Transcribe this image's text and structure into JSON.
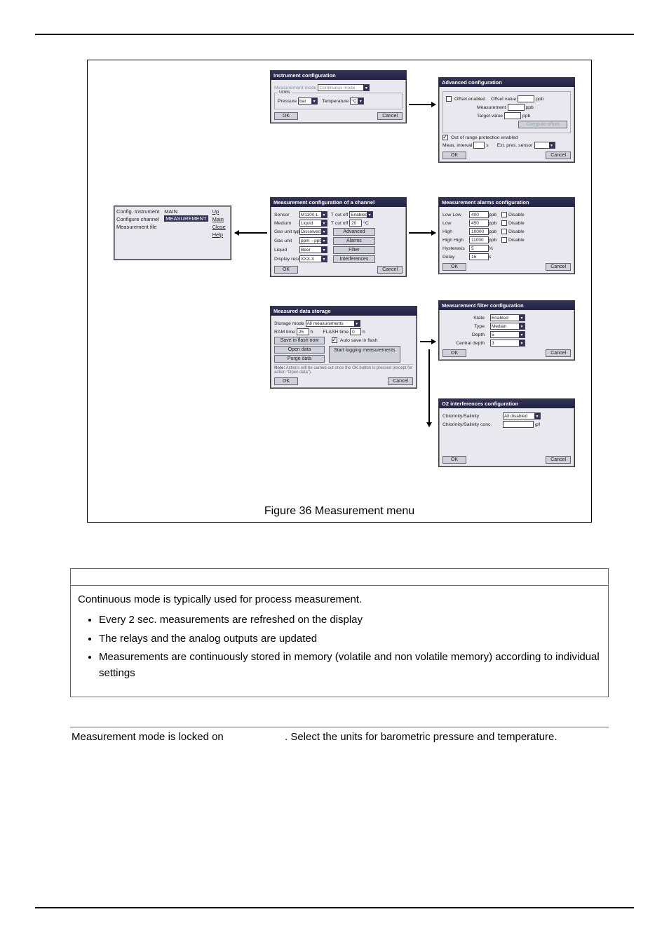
{
  "figure_caption": "Figure 36  Measurement menu",
  "menuwin": {
    "c1": [
      "Config. Instrument",
      "Configure channel",
      "Measurement file"
    ],
    "c2_hdr": "MAIN",
    "c2_hl": "MEASUREMENT",
    "c3": [
      "Up",
      "Main",
      "Close",
      "Help"
    ]
  },
  "instr": {
    "title": "Instrument configuration",
    "meas_mode_lbl": "Measurement mode",
    "meas_mode_val": "Continuous mode",
    "units_group": "Units",
    "press_lbl": "Pressure",
    "press_val": "bar",
    "temp_lbl": "Temperature",
    "temp_val": "°C",
    "ok": "OK",
    "cancel": "Cancel"
  },
  "adv": {
    "title": "Advanced configuration",
    "offset_enabled": "Offset enabled",
    "offset_value": "Offset value",
    "offset_u": "ppb",
    "measurement": "Measurement",
    "meas_u": "ppb",
    "target_value": "Target value",
    "target_u": "ppb",
    "compute_offset": "Compute offset",
    "oor": "Out of range protection enabled",
    "meas_interval": "Meas. interval",
    "s": "s",
    "ext_press": "Ext. pres. sensor",
    "ok": "OK",
    "cancel": "Cancel"
  },
  "chan": {
    "title": "Measurement configuration of a channel",
    "sensor": "Sensor",
    "sensor_v": "M1100-L",
    "tcutoff": "T cut off",
    "enabled": "Enabled",
    "medium": "Medium",
    "medium_v": "Liquid",
    "tcutoff2": "T cut off",
    "tval": "20",
    "gas_type": "Gas unit type",
    "gas_type_v": "Dissolved",
    "advanced": "Advanced",
    "gas_unit": "Gas unit",
    "gas_unit_v": "ppm→ppb",
    "alarms": "Alarms",
    "liquid": "Liquid",
    "liquid_v": "Beer",
    "filter": "Filter",
    "disp_res": "Display resolution",
    "disp_res_v": "XXX.X",
    "interf": "Interferences",
    "ok": "OK",
    "cancel": "Cancel"
  },
  "alarms": {
    "title": "Measurement alarms configuration",
    "rows": [
      {
        "l": "Low Low",
        "v": "400",
        "u": "ppb",
        "d": "Disable"
      },
      {
        "l": "Low",
        "v": "450",
        "u": "ppb",
        "d": "Disable"
      },
      {
        "l": "High",
        "v": "10000",
        "u": "ppb",
        "d": "Disable"
      },
      {
        "l": "High High",
        "v": "11000",
        "u": "ppb",
        "d": "Disable"
      }
    ],
    "hyst": "Hysteresis",
    "hyst_v": "5",
    "hyst_u": "%",
    "delay": "Delay",
    "delay_v": "15",
    "delay_u": "s",
    "ok": "OK",
    "cancel": "Cancel"
  },
  "store": {
    "title": "Measured data storage",
    "mode": "Storage mode",
    "mode_v": "All measurements",
    "ram": "RAM time",
    "ram_v": "25",
    "ram_u": "h",
    "flash": "FLASH time",
    "flash_v": "0",
    "flash_u": "h",
    "save_flash": "Save in flash now",
    "auto": "Auto save in flash",
    "open": "Open data",
    "start": "Start logging measurements",
    "purge": "Purge data",
    "note_l": "Note:",
    "note": "Actions will be carried out once the OK button is pressed (except for action \"Open data\").",
    "ok": "OK",
    "cancel": "Cancel"
  },
  "mfilter": {
    "title": "Measurement filter configuration",
    "state": "State",
    "state_v": "Enabled",
    "type": "Type",
    "type_v": "Median",
    "depth": "Depth",
    "depth_v": "5",
    "cdepth": "Central depth",
    "cdepth_v": "3",
    "ok": "OK",
    "cancel": "Cancel"
  },
  "o2": {
    "title": "O2 interferences configuration",
    "chlor": "Chlorinity/Salinity",
    "chlor_v": "All disabled",
    "conc": "Chlorinity/Salinity conc.",
    "conc_u": "g/l",
    "ok": "OK",
    "cancel": "Cancel"
  },
  "text": {
    "p1": "Continuous mode is typically used for process measurement.",
    "li1": "Every 2 sec. measurements are refreshed on the display",
    "li2": "The relays and the analog outputs are updated",
    "li3": "Measurements are continuously stored in memory (volatile and non volatile memory) according to individual settings",
    "row2a": "Measurement mode is locked on ",
    "row2b": ". Select the units for barometric pressure and temperature."
  }
}
